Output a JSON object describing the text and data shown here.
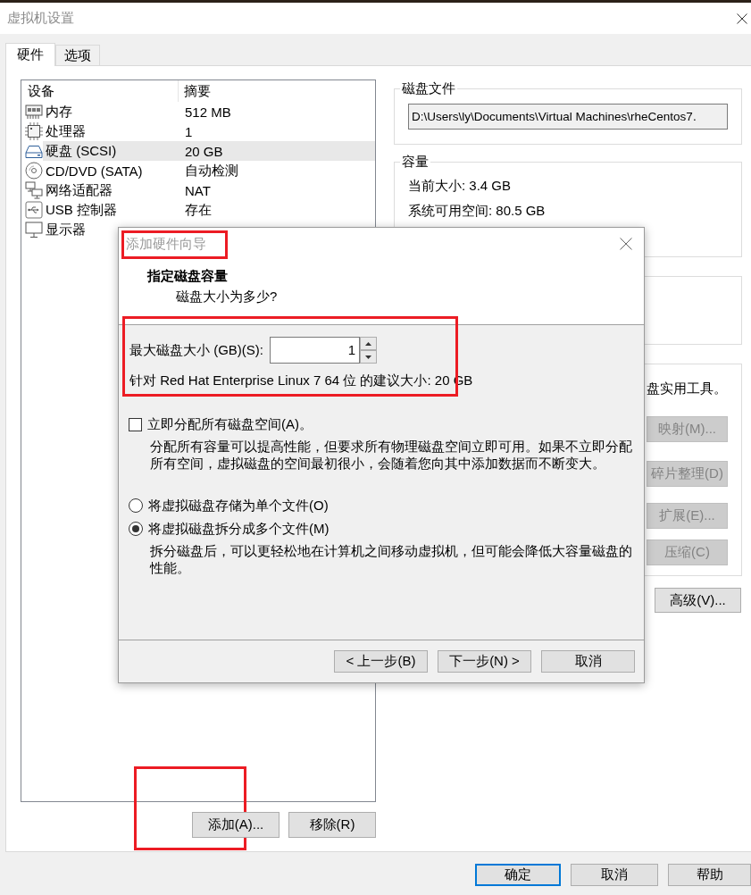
{
  "window": {
    "title": "虚拟机设置"
  },
  "tabs": [
    {
      "label": "硬件",
      "selected": true
    },
    {
      "label": "选项",
      "selected": false
    }
  ],
  "devices": {
    "columns": [
      "设备",
      "摘要"
    ],
    "rows": [
      {
        "kind": "memory",
        "name": "内存",
        "summary": "512 MB",
        "selected": false
      },
      {
        "kind": "cpu",
        "name": "处理器",
        "summary": "1",
        "selected": false
      },
      {
        "kind": "disk",
        "name": "硬盘 (SCSI)",
        "summary": "20 GB",
        "selected": true
      },
      {
        "kind": "cdrom",
        "name": "CD/DVD (SATA)",
        "summary": "自动检测",
        "selected": false
      },
      {
        "kind": "network",
        "name": "网络适配器",
        "summary": "NAT",
        "selected": false
      },
      {
        "kind": "usb",
        "name": "USB 控制器",
        "summary": "存在",
        "selected": false
      },
      {
        "kind": "display",
        "name": "显示器",
        "selected": false
      }
    ]
  },
  "device_buttons": [
    {
      "label": "添加(A)...",
      "highlighted": true
    },
    {
      "label": "移除(R)",
      "highlighted": false
    }
  ],
  "disk_file": {
    "title": "磁盘文件",
    "path": "D:\\Users\\ly\\Documents\\Virtual Machines\\rheCentos7."
  },
  "capacity": {
    "title": "容量",
    "lines": [
      "当前大小: 3.4 GB",
      "系统可用空间: 80.5 GB"
    ]
  },
  "disk_utilities": {
    "text": "盘实用工具。",
    "buttons": [
      {
        "label": "映射(M)...",
        "disabled": true
      },
      {
        "label": "碎片整理(D)",
        "disabled": true
      },
      {
        "label": "扩展(E)...",
        "disabled": true
      },
      {
        "label": "压缩(C)",
        "disabled": true
      }
    ]
  },
  "advanced_button": {
    "label": "高级(V)...",
    "disabled": false
  },
  "footer_buttons": [
    {
      "label": "确定",
      "focused": true
    },
    {
      "label": "取消",
      "focused": false
    },
    {
      "label": "帮助",
      "focused": false
    }
  ],
  "dialog": {
    "title": "添加硬件向导",
    "title_highlighted": true,
    "heading": "指定磁盘容量",
    "subheading": "磁盘大小为多少?",
    "size": {
      "label": "最大磁盘大小 (GB)(S):",
      "value": "1",
      "hint": "针对 Red Hat Enterprise Linux 7 64 位 的建议大小: 20 GB",
      "highlighted": true
    },
    "allocate": {
      "label": "立即分配所有磁盘空间(A)。",
      "checked": false,
      "description": "分配所有容量可以提高性能，但要求所有物理磁盘空间立即可用。如果不立即分配所有空间，虚拟磁盘的空间最初很小，会随着您向其中添加数据而不断变大。"
    },
    "storage_options": [
      {
        "label": "将虚拟磁盘存储为单个文件(O)",
        "selected": false
      },
      {
        "label": "将虚拟磁盘拆分成多个文件(M)",
        "selected": true,
        "description": "拆分磁盘后，可以更轻松地在计算机之间移动虚拟机，但可能会降低大容量磁盘的性能。"
      }
    ],
    "buttons": [
      "< 上一步(B)",
      "下一步(N) >",
      "取消"
    ]
  }
}
